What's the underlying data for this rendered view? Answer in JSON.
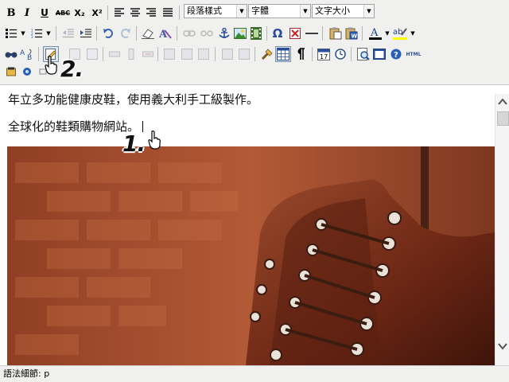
{
  "toolbar": {
    "row1": {
      "bold": "B",
      "italic": "I",
      "underline": "U",
      "strike": "ABC",
      "subscript": "X₂",
      "superscript": "X²",
      "format_select": "段落樣式",
      "font_select": "字體",
      "size_select": "文字大小"
    },
    "row2": {
      "special_char": "Ω"
    },
    "row3": {
      "html_button": "HTML"
    }
  },
  "content": {
    "paragraph1": "年立多功能健康皮鞋，使用義大利手工級製作。",
    "paragraph2": "全球化的鞋類購物網站。"
  },
  "annotations": {
    "step1": "1.",
    "step2": "2."
  },
  "status_bar": {
    "path": "語法細節: p"
  },
  "colors": {
    "toolbar_bg": "#f0f0ee",
    "font_color_bar": "#000000",
    "highlight_bar": "#ffff00",
    "brick": "#a24d2e",
    "leather": "#7a2c16"
  },
  "icons": [
    "align-left-icon",
    "align-center-icon",
    "align-right-icon",
    "align-justify-icon",
    "bullet-list-icon",
    "numbered-list-icon",
    "outdent-icon",
    "indent-icon",
    "undo-icon",
    "redo-icon",
    "eraser-icon",
    "cleanup-icon",
    "link-icon",
    "unlink-icon",
    "anchor-icon",
    "image-icon",
    "media-icon",
    "special-char-icon",
    "flash-icon",
    "horizontal-rule-icon",
    "paste-text-icon",
    "paste-word-icon",
    "font-color-icon",
    "highlight-icon",
    "find-icon",
    "replace-icon",
    "edit-icon",
    "table-icon",
    "visual-aid-icon",
    "pilcrow-icon",
    "insert-date-icon",
    "insert-time-icon",
    "preview-icon",
    "fullscreen-icon",
    "help-icon",
    "html-icon"
  ]
}
